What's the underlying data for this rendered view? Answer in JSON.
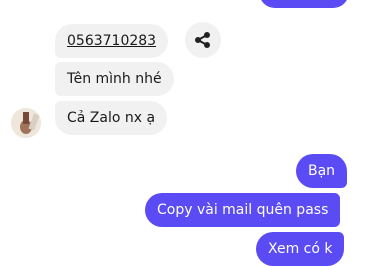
{
  "conversation": {
    "incoming": [
      {
        "text": "0563710283"
      },
      {
        "text": "Tên mình nhé"
      },
      {
        "text": "Cả Zalo nx ạ"
      }
    ],
    "outgoing": [
      {
        "text": "Bạn"
      },
      {
        "text": "Copy vài mail quên pass"
      },
      {
        "text": "Xem có k"
      }
    ]
  },
  "icons": {
    "share": "share-icon",
    "avatar": "contact-avatar"
  },
  "colors": {
    "incoming_bubble": "#f1f1f1",
    "outgoing_bubble": "#5a4bf5",
    "outgoing_text": "#ffffff"
  }
}
